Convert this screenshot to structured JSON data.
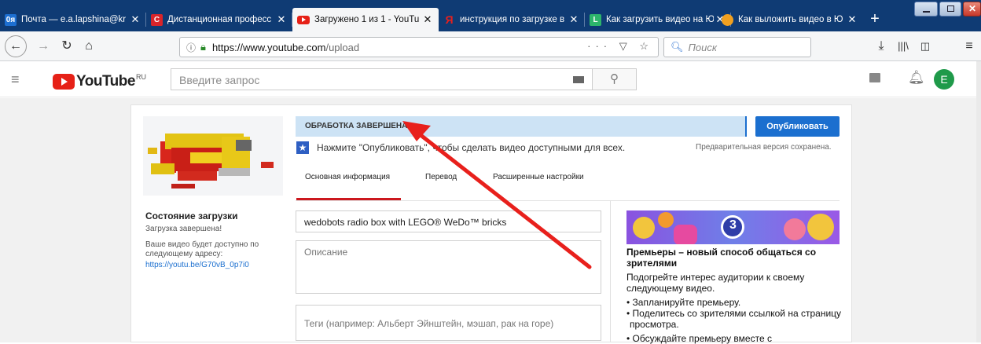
{
  "browser": {
    "tabs": [
      {
        "title": "Почта — e.a.lapshina@kr",
        "icon": "mail-icon",
        "fav_text": "0ᴙ"
      },
      {
        "title": "Дистанционная професс",
        "icon": "c-logo-icon",
        "fav_text": "C"
      },
      {
        "title": "Загружено 1 из 1 - YouTu",
        "icon": "youtube-icon",
        "fav_text": ""
      },
      {
        "title": "инструкция по загрузке в",
        "icon": "yandex-icon",
        "fav_text": "Я"
      },
      {
        "title": "Как загрузить видео на Ю",
        "icon": "l-logo-icon",
        "fav_text": "L"
      },
      {
        "title": "Как выложить видео в Ю",
        "icon": "bulb-icon",
        "fav_text": ""
      }
    ],
    "close_glyph": "✕",
    "new_tab": "+",
    "url_host": "https://www.youtube.com",
    "url_path": "/upload",
    "search_placeholder": "Поиск",
    "url_actions": "··· ▽ ☆"
  },
  "youtube": {
    "logo_text": "YouTube",
    "region": "RU",
    "search_placeholder": "Введите запрос",
    "avatar_letter": "E"
  },
  "upload": {
    "processing_status": "ОБРАБОТКА ЗАВЕРШЕНА",
    "publish_button": "Опубликовать",
    "hint": "Нажмите \"Опубликовать\", чтобы сделать видео доступными для всех.",
    "saved_note": "Предварительная версия сохранена.",
    "tabs": [
      "Основная информация",
      "Перевод",
      "Расширенные настройки"
    ],
    "status_title": "Состояние загрузки",
    "status_done": "Загрузка завершена!",
    "status_link_note": "Ваше видео будет доступно по следующему адресу:",
    "video_url": "https://youtu.be/G70vB_0p7i0",
    "title_value": "wedobots  radio box with LEGO® WeDo™ bricks",
    "description_placeholder": "Описание",
    "tags_placeholder": "Теги (например: Альберт Эйнштейн, мэшап, рак на горе)"
  },
  "premiere": {
    "badge": "3",
    "title": "Премьеры – новый способ общаться со зрителями",
    "intro": "Подогрейте интерес аудитории к своему следующему видео.",
    "bullets": [
      "• Запланируйте премьеру.",
      "• Поделитесь со зрителями ссылкой на страницу просмотра.",
      "• Обсуждайте премьеру вместе с"
    ]
  },
  "colors": {
    "tabbar": "#0f3b74",
    "youtube_red": "#e62117",
    "publish_blue": "#1b6fcf",
    "status_bg": "#cde3f5",
    "annotation_arrow": "#e8201c",
    "avatar": "#1f9a4a"
  }
}
